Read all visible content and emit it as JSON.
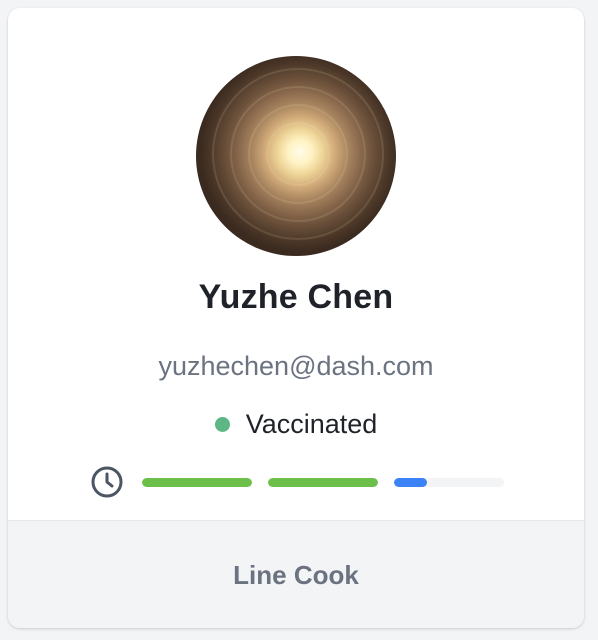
{
  "profile": {
    "name": "Yuzhe Chen",
    "email": "yuzhechen@dash.com",
    "status": "Vaccinated",
    "status_color": "#5db785",
    "role": "Line Cook"
  },
  "progress": {
    "icon": "clock-icon",
    "segments": [
      {
        "fraction": 1.0,
        "color": "#6cc04a"
      },
      {
        "fraction": 1.0,
        "color": "#6cc04a"
      },
      {
        "fraction": 0.3,
        "color": "#3b82f6"
      }
    ]
  }
}
